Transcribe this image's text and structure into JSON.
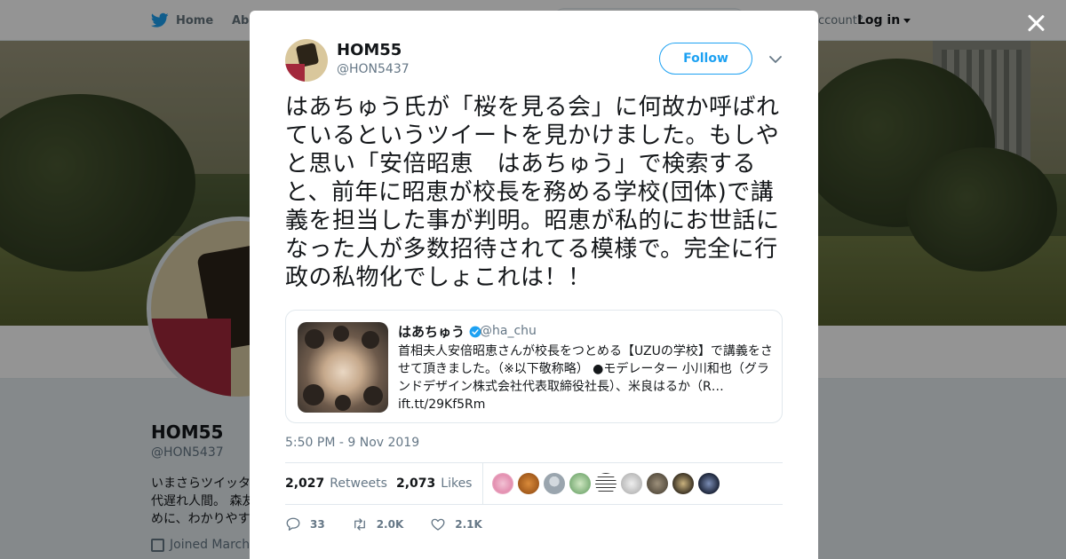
{
  "topnav": {
    "home_label": "Home",
    "about_label": "Abo",
    "have_account": "ccount?",
    "login_label": "Log in"
  },
  "profile": {
    "name": "HOM55",
    "handle": "@HON5437",
    "bio_lines": [
      "いまさらツイッタ",
      "代遅れ人間。 森友",
      "めに、わかりやす"
    ],
    "joined": "Joined March"
  },
  "tweet": {
    "author_name": "HOM55",
    "author_handle": "@HON5437",
    "follow_label": "Follow",
    "text": "はあちゅう氏が「桜を見る会」に何故か呼ばれているというツイートを見かけました。もしやと思い「安倍昭恵　はあちゅう」で検索すると、前年に昭恵が校長を務める学校(団体)で講義を担当した事が判明。昭恵が私的にお世話になった人が多数招待されてる模様で。完全に行政の私物化でしょこれは！！",
    "timestamp": "5:50 PM - 9 Nov 2019",
    "retweets_count": "2,027",
    "retweets_label": "Retweets",
    "likes_count": "2,073",
    "likes_label": "Likes",
    "reply_count": "33",
    "retweet_action_count": "2.0K",
    "like_action_count": "2.1K"
  },
  "quote": {
    "name": "はあちゅう",
    "handle": "@ha_chu",
    "text": "首相夫人安倍昭恵さんが校長をつとめる【UZUの学校】で講義をさせて頂きました。（※以下敬称略） ●モデレーター 小川和也（グランドデザイン株式会社代表取締役社長）、米良はるか（R… ",
    "link": "ift.tt/29Kf5Rm"
  },
  "colors": {
    "accent": "#1da1f2",
    "text": "#14171a",
    "muted": "#657786"
  },
  "icons": [
    "twitter-bird-icon",
    "chevron-down-icon",
    "verified-badge-icon",
    "reply-icon",
    "retweet-icon",
    "heart-icon",
    "calendar-icon",
    "close-icon"
  ]
}
